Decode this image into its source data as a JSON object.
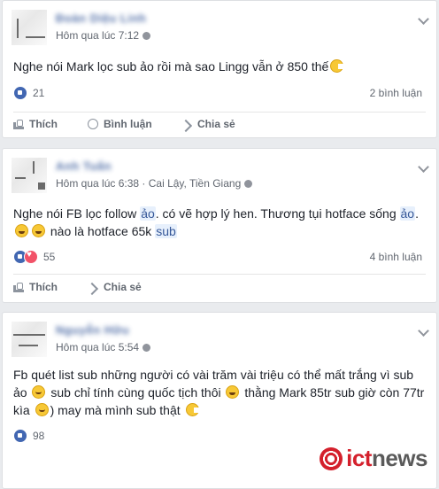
{
  "posts": [
    {
      "author": "Đoàn Diệu Linh",
      "time": "Hôm qua lúc 7:12",
      "location": "",
      "text_parts": [
        "Nghe nói Mark lọc sub ảo rồi mà sao Lingg vẫn ở 850 thế"
      ],
      "reaction_count": "21",
      "comments_label": "2 bình luận",
      "actions": {
        "like": "Thích",
        "comment": "Bình luận",
        "share": "Chia sẻ"
      }
    },
    {
      "author": "Anh Tuấn",
      "time": "Hôm qua lúc 6:38",
      "location": "Cai Lậy, Tiền Giang",
      "text_parts": [
        "Nghe nói FB lọc follow ",
        "ảo",
        ". có vẽ hợp lý hen. Thương tụi hotface sống ",
        "ảo",
        ".",
        " nào là hotface 65k ",
        "sub"
      ],
      "reaction_count": "55",
      "comments_label": "4 bình luận",
      "actions": {
        "like": "Thích",
        "share": "Chia sẻ"
      }
    },
    {
      "author": "Nguyễn Hữu",
      "time": "Hôm qua lúc 5:54",
      "location": "",
      "text_parts": [
        "Fb quét list sub những người có vài trăm vài triệu có thể mất trắng vì sub ảo",
        "sub chỉ tính cùng quốc tịch thôi",
        "thằng Mark 85tr sub giờ còn 77tr kìa",
        ") may mà mình sub thật"
      ],
      "reaction_count": "98"
    }
  ],
  "watermark": {
    "prefix": "ict",
    "suffix": "news"
  },
  "icons": [
    "globe-icon",
    "chevron-down-icon",
    "like-reaction-icon",
    "love-reaction-icon",
    "thumbs-up-icon",
    "comment-icon",
    "share-icon",
    "emoji-icon"
  ],
  "colors": {
    "link": "#365899",
    "meta": "#616770",
    "like": "#4267b2",
    "love": "#f25268",
    "brand_red": "#d4202c"
  }
}
